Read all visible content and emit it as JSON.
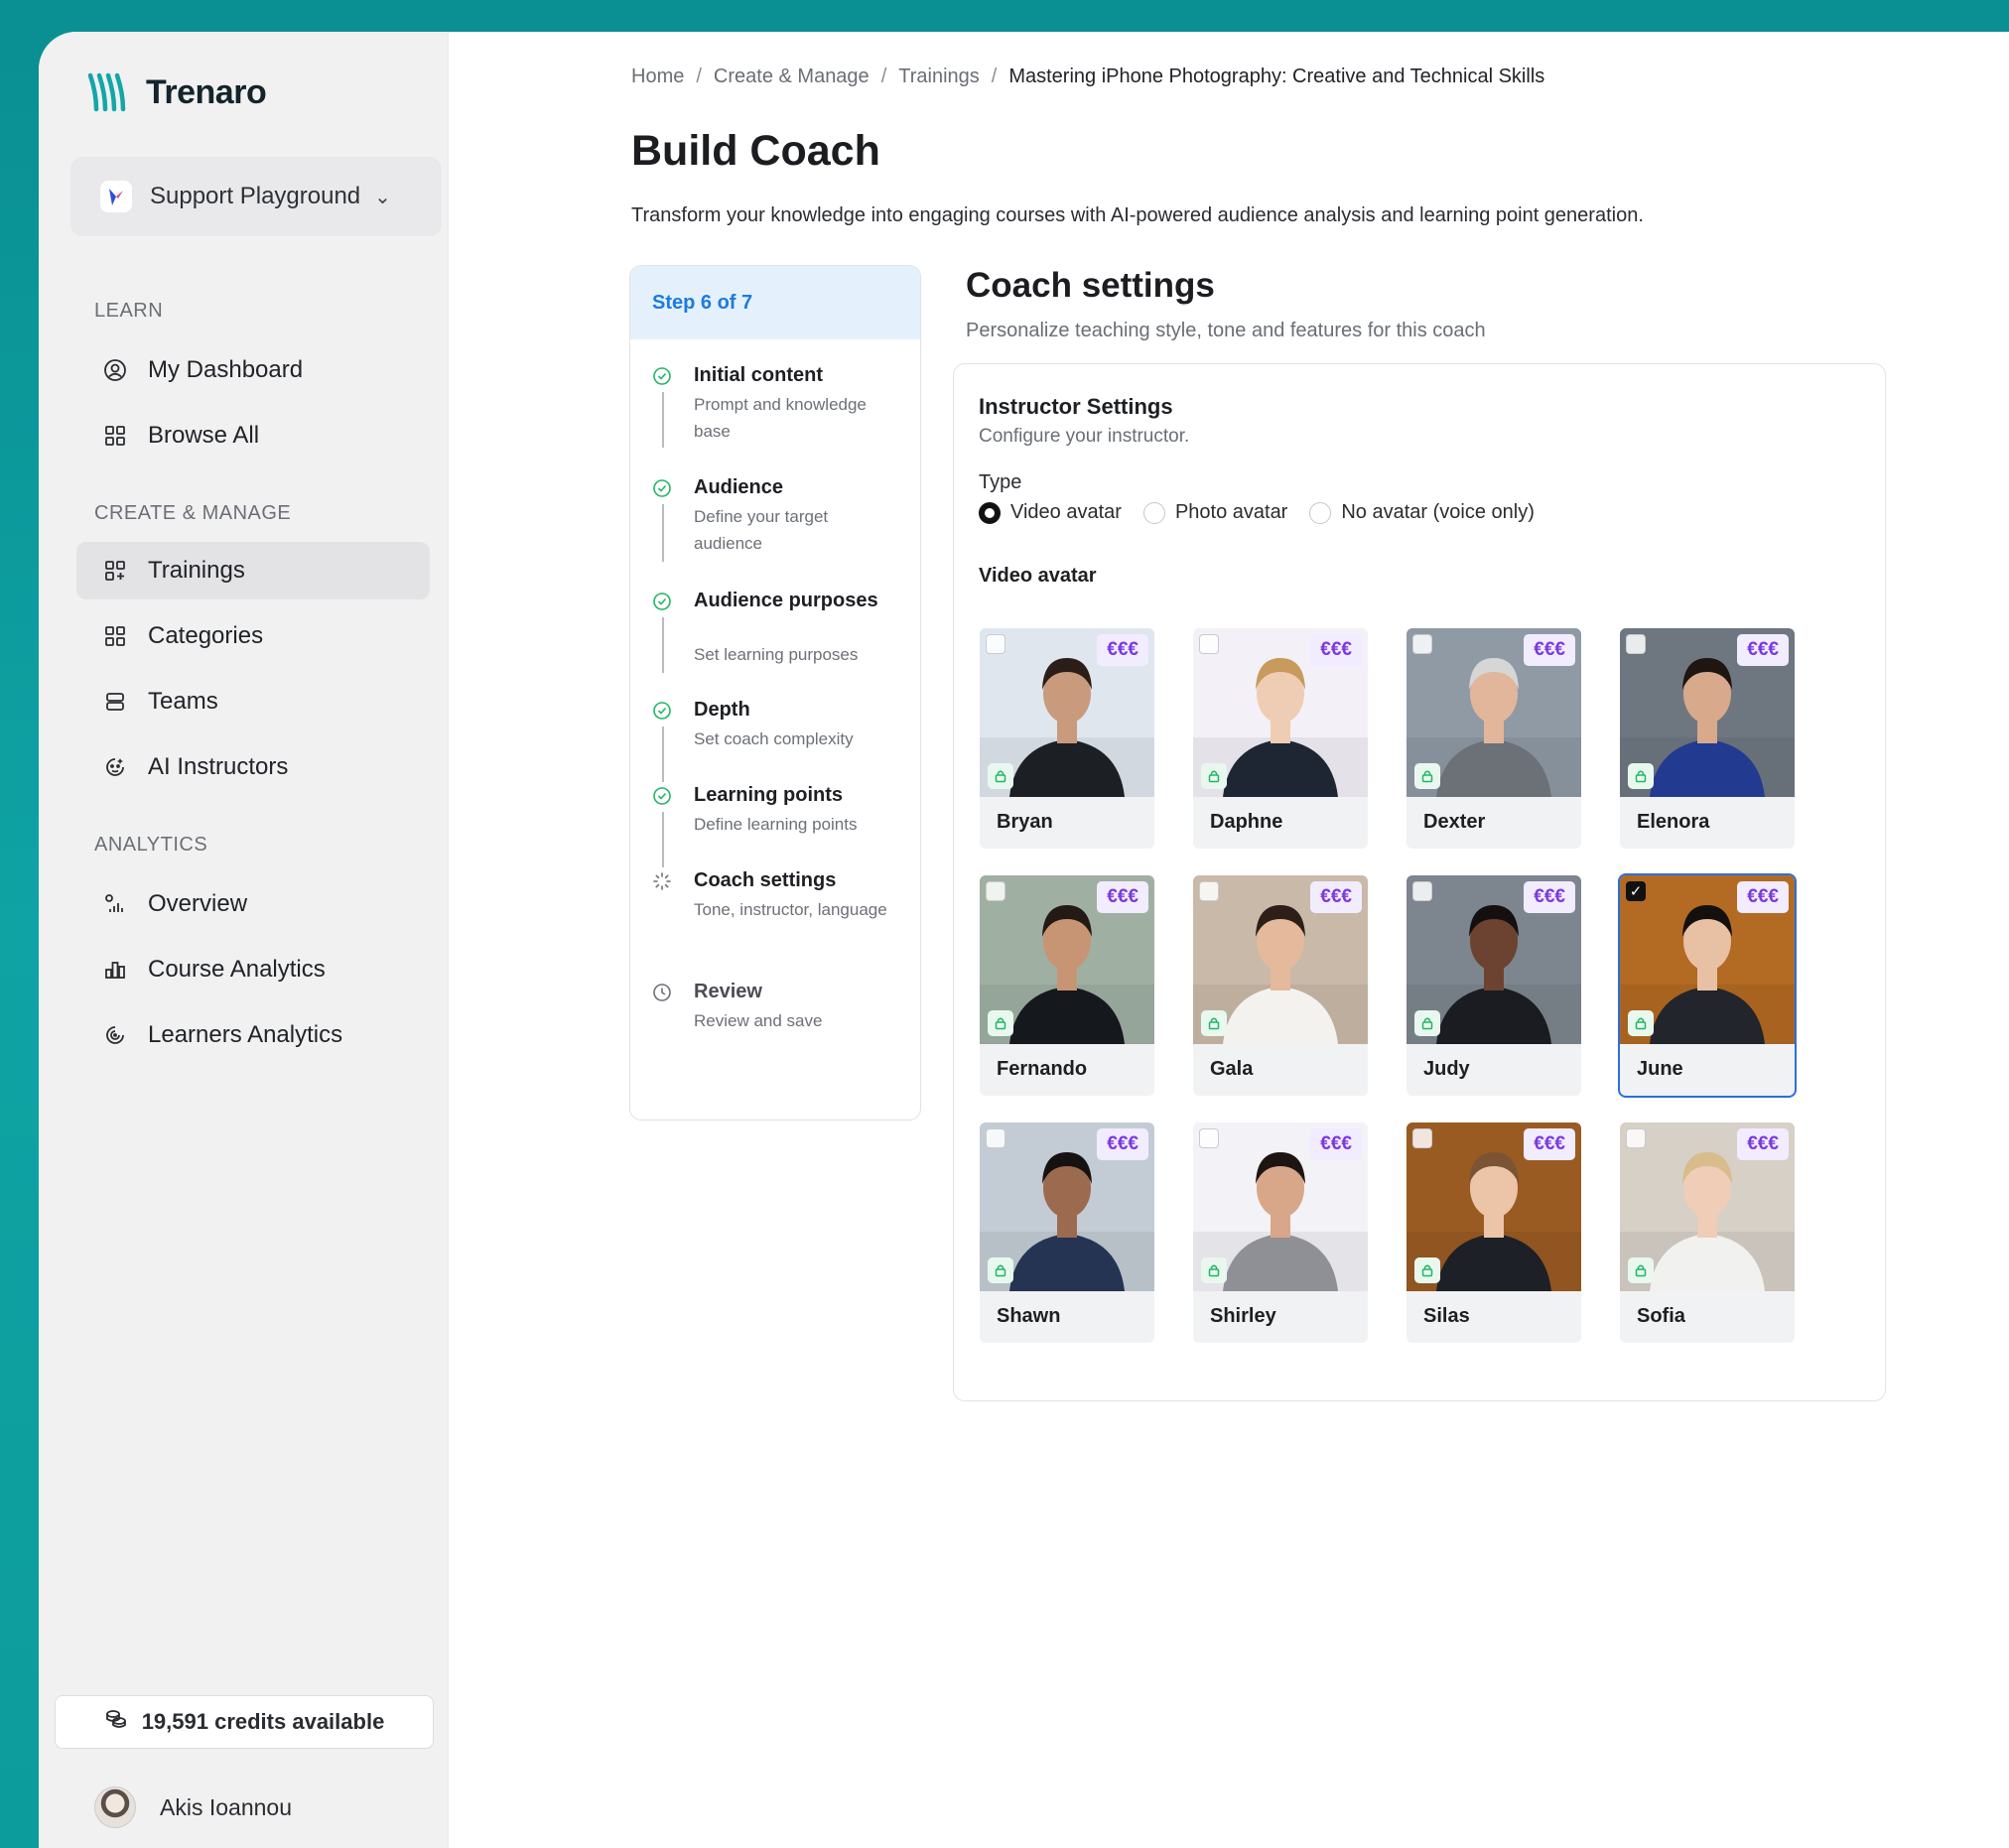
{
  "app": {
    "name": "Trenaro"
  },
  "org": {
    "name": "Support Playground"
  },
  "sidebar": {
    "sections": [
      {
        "label": "LEARN",
        "items": [
          {
            "label": "My Dashboard",
            "icon": "user-circle-icon"
          },
          {
            "label": "Browse All",
            "icon": "grid-icon"
          }
        ]
      },
      {
        "label": "CREATE & MANAGE",
        "items": [
          {
            "label": "Trainings",
            "icon": "grid-plus-icon",
            "active": true
          },
          {
            "label": "Categories",
            "icon": "grid-icon"
          },
          {
            "label": "Teams",
            "icon": "stack-icon"
          },
          {
            "label": "AI Instructors",
            "icon": "face-icon"
          }
        ]
      },
      {
        "label": "ANALYTICS",
        "items": [
          {
            "label": "Overview",
            "icon": "chart-dots-icon"
          },
          {
            "label": "Course Analytics",
            "icon": "bar-chart-icon"
          },
          {
            "label": "Learners Analytics",
            "icon": "target-icon"
          }
        ]
      }
    ],
    "credits": "19,591 credits available",
    "user": "Akis Ioannou"
  },
  "breadcrumb": [
    "Home",
    "Create & Manage",
    "Trainings",
    "Mastering iPhone Photography: Creative and Technical Skills"
  ],
  "page": {
    "title": "Build Coach",
    "description": "Transform your knowledge into engaging courses with AI-powered audience analysis and learning point generation."
  },
  "stepper": {
    "header": "Step 6 of 7",
    "steps": [
      {
        "title": "Initial content",
        "sub": "Prompt and knowledge base",
        "status": "done"
      },
      {
        "title": "Audience",
        "sub": "Define your target audience",
        "status": "done"
      },
      {
        "title": "Audience purposes",
        "sub": "Set learning purposes",
        "status": "done"
      },
      {
        "title": "Depth",
        "sub": "Set coach complexity",
        "status": "done"
      },
      {
        "title": "Learning points",
        "sub": "Define learning points",
        "status": "done"
      },
      {
        "title": "Coach settings",
        "sub": "Tone, instructor, language",
        "status": "current"
      },
      {
        "title": "Review",
        "sub": "Review and save",
        "status": "pending"
      }
    ]
  },
  "settings": {
    "title": "Coach settings",
    "subtitle": "Personalize teaching style, tone and features for this coach",
    "card_title": "Instructor Settings",
    "card_sub": "Configure your instructor.",
    "type_label": "Type",
    "types": [
      {
        "label": "Video avatar",
        "selected": true
      },
      {
        "label": "Photo avatar",
        "selected": false
      },
      {
        "label": "No avatar (voice only)",
        "selected": false
      }
    ],
    "video_label": "Video avatar",
    "price_label": "€€€",
    "avatars": [
      {
        "name": "Bryan",
        "selected": false,
        "bg": "#dfe6ee",
        "skin": "#c99a7c",
        "hair": "#2b1e18",
        "shirt": "#1c1f24"
      },
      {
        "name": "Daphne",
        "selected": false,
        "bg": "#f3f1f7",
        "skin": "#efcdb5",
        "hair": "#c89a5c",
        "shirt": "#1e2533"
      },
      {
        "name": "Dexter",
        "selected": false,
        "bg": "#8f9aa5",
        "skin": "#e2b69b",
        "hair": "#d6d6d6",
        "shirt": "#6c7178"
      },
      {
        "name": "Elenora",
        "selected": false,
        "bg": "#6e7780",
        "skin": "#d8a98a",
        "hair": "#1d1612",
        "shirt": "#223a8f"
      },
      {
        "name": "Fernando",
        "selected": false,
        "bg": "#9fb0a3",
        "skin": "#c79474",
        "hair": "#231a16",
        "shirt": "#15181c"
      },
      {
        "name": "Gala",
        "selected": false,
        "bg": "#c9b9a8",
        "skin": "#e4b99c",
        "hair": "#2d1e17",
        "shirt": "#f4f2ef"
      },
      {
        "name": "Judy",
        "selected": false,
        "bg": "#7d858e",
        "skin": "#6b4330",
        "hair": "#151010",
        "shirt": "#1a1c22"
      },
      {
        "name": "June",
        "selected": true,
        "bg": "#b36a22",
        "skin": "#e8c0a4",
        "hair": "#14100e",
        "shirt": "#22252b"
      },
      {
        "name": "Shawn",
        "selected": false,
        "bg": "#c3ccd4",
        "skin": "#9c6a4e",
        "hair": "#161212",
        "shirt": "#243452"
      },
      {
        "name": "Shirley",
        "selected": false,
        "bg": "#f3f2f6",
        "skin": "#d8a689",
        "hair": "#1c1512",
        "shirt": "#8f9096"
      },
      {
        "name": "Silas",
        "selected": false,
        "bg": "#9a5b23",
        "skin": "#ecc4a8",
        "hair": "#7a5434",
        "shirt": "#1d2026"
      },
      {
        "name": "Sofia",
        "selected": false,
        "bg": "#d6d0c7",
        "skin": "#efcdb6",
        "hair": "#d8bc8c",
        "shirt": "#f1f1ef"
      }
    ]
  },
  "colors": {
    "accent": "#1d7ae0",
    "success": "#22b567",
    "premium": "#7b3ae0",
    "brand": "#0fa3a3"
  }
}
